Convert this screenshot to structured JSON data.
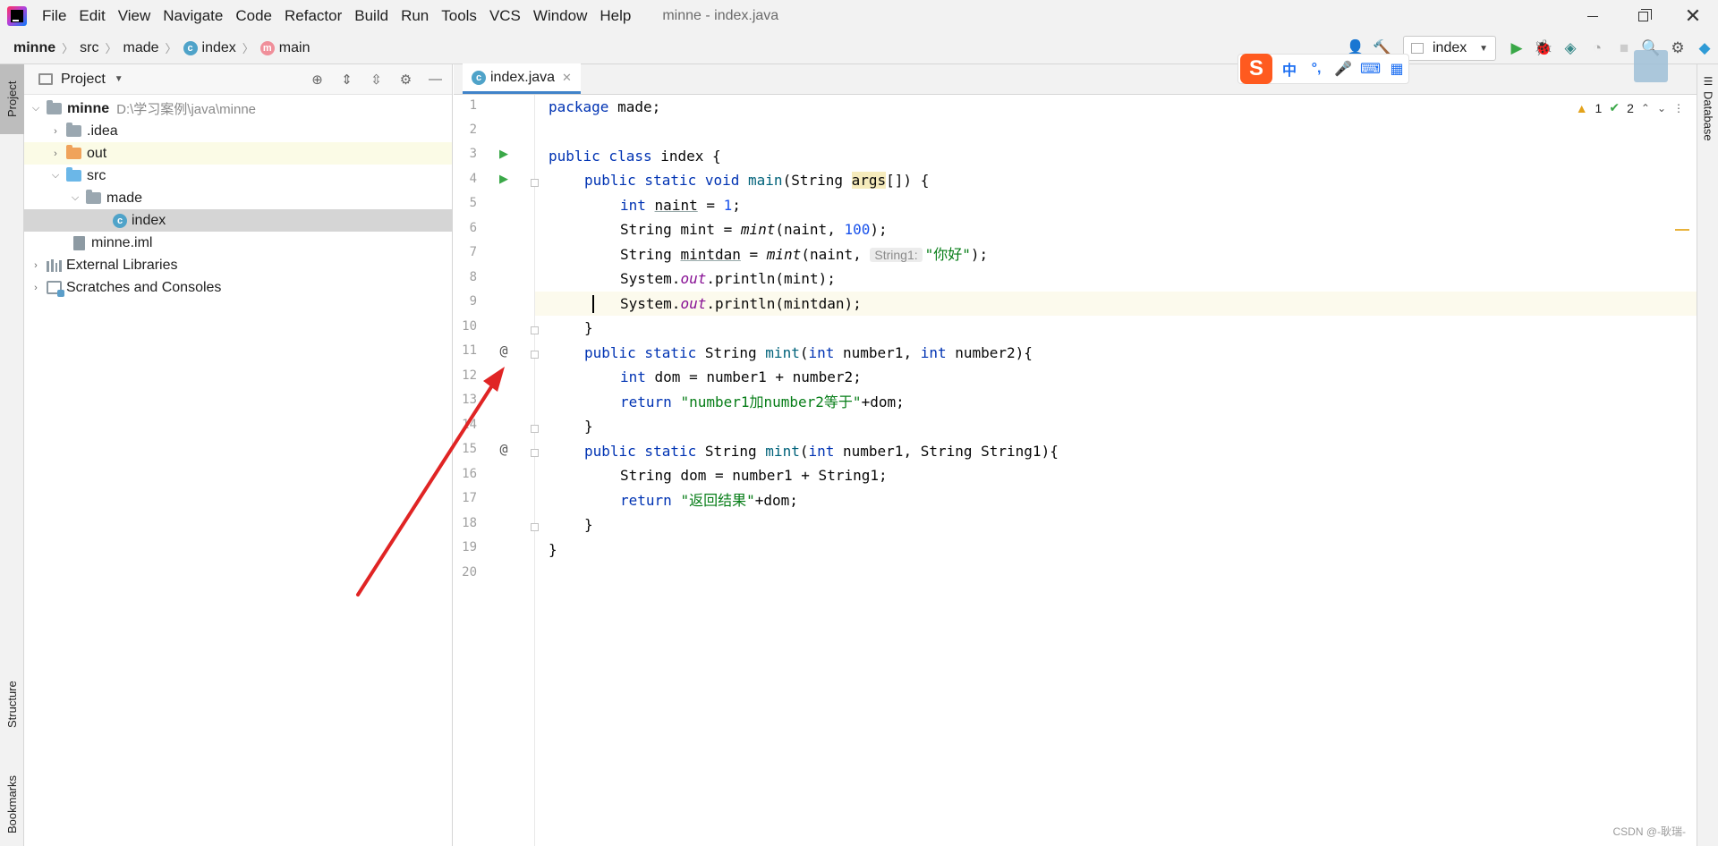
{
  "menubar": {
    "items": [
      "File",
      "Edit",
      "View",
      "Navigate",
      "Code",
      "Refactor",
      "Build",
      "Run",
      "Tools",
      "VCS",
      "Window",
      "Help"
    ],
    "window_title": "minne - index.java"
  },
  "navbar": {
    "breadcrumb": [
      "minne",
      "src",
      "made",
      "index",
      "main"
    ],
    "run_config": "index"
  },
  "left_strip": {
    "project": "Project",
    "structure": "Structure",
    "bookmarks": "Bookmarks"
  },
  "right_strip": {
    "database": "Database"
  },
  "project_panel": {
    "title": "Project",
    "tree": {
      "root_name": "minne",
      "root_path": "D:\\学习案例\\java\\minne",
      "idea": ".idea",
      "out": "out",
      "src": "src",
      "made": "made",
      "index": "index",
      "iml": "minne.iml",
      "external_libraries": "External Libraries",
      "scratches": "Scratches and Consoles"
    }
  },
  "editor": {
    "tab_label": "index.java",
    "warnings_count": "1",
    "ok_count": "2",
    "line_numbers": [
      "1",
      "2",
      "3",
      "4",
      "5",
      "6",
      "7",
      "8",
      "9",
      "10",
      "11",
      "12",
      "13",
      "14",
      "15",
      "16",
      "17",
      "18",
      "19",
      "20"
    ],
    "code": {
      "l1_kw": "package",
      "l1_rest": " made;",
      "l3_kw": "public class",
      "l3_rest": " index {",
      "l4_kw": "public static void",
      "l4_fn": "main",
      "l4_a": "(String ",
      "l4_arg": "args",
      "l4_b": "[]) {",
      "l5_kw": "int",
      "l5_var": "naint",
      "l5_a": " = ",
      "l5_num": "1",
      "l5_b": ";",
      "l6_a": "String mint = ",
      "l6_fn": "mint",
      "l6_b": "(naint, ",
      "l6_num": "100",
      "l6_c": ");",
      "l7_a": "String ",
      "l7_var": "mintdan",
      "l7_b": " = ",
      "l7_fn": "mint",
      "l7_c": "(naint, ",
      "l7_hint": "String1:",
      "l7_str": "\"你好\"",
      "l7_d": ");",
      "l8_a": "System.",
      "l8_fld": "out",
      "l8_b": ".println(mint);",
      "l9_a": "System.",
      "l9_fld": "out",
      "l9_b": ".println(mintdan);",
      "l10": "}",
      "l11_kw": "public static",
      "l11_a": " String ",
      "l11_fn": "mint",
      "l11_b": "(",
      "l11_kw2": "int",
      "l11_c": " number1, ",
      "l11_kw3": "int",
      "l11_d": " number2){",
      "l12_kw": "int",
      "l12_rest": " dom = number1 + number2;",
      "l13_kw": "return",
      "l13_str": "\"number1加number2等于\"",
      "l13_rest": "+dom;",
      "l14": "}",
      "l15_kw": "public static",
      "l15_a": " String ",
      "l15_fn": "mint",
      "l15_b": "(",
      "l15_kw2": "int",
      "l15_c": " number1, String String1){",
      "l16": "String dom = number1 + String1;",
      "l17_kw": "return",
      "l17_str": "\"返回结果\"",
      "l17_rest": "+dom;",
      "l18": "}",
      "l19": "}"
    }
  },
  "ime": {
    "s": "S",
    "zh": "中",
    "punct": "°,",
    "mic": "🎤",
    "kbd": "⌨",
    "grid": "▦"
  },
  "watermark": "CSDN @-耿瑞-",
  "colors": {
    "keyword": "#0033b3",
    "string": "#067d17",
    "number": "#1750eb",
    "accent": "#4083c9",
    "arrow": "#e02424"
  }
}
